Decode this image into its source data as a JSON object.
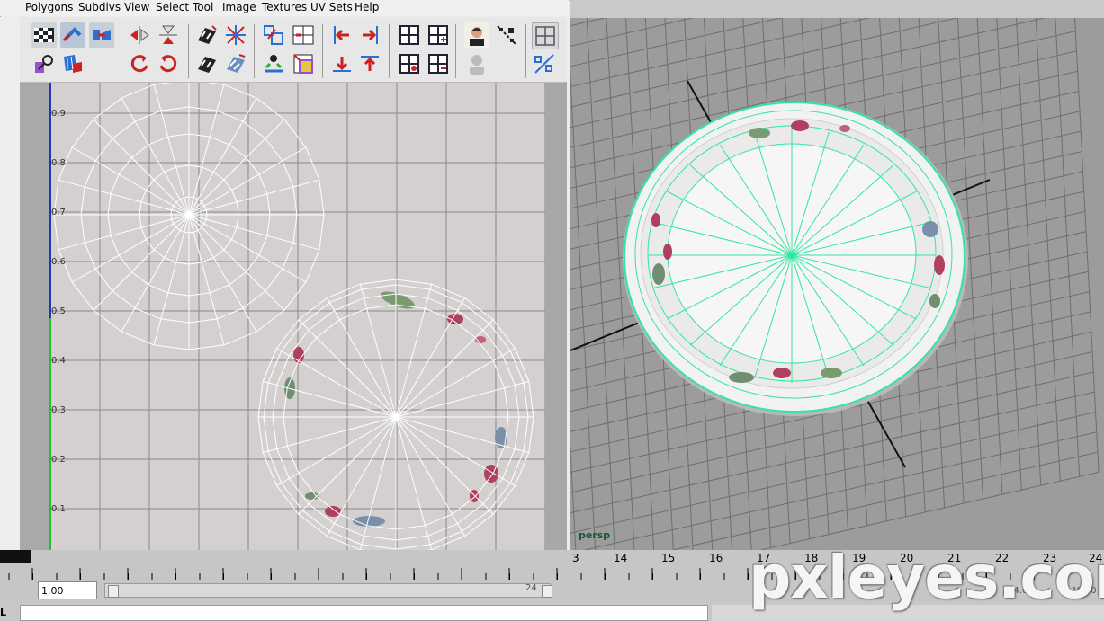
{
  "menubar": {
    "items": [
      "Polygons",
      "Subdivs",
      "View",
      "Select",
      "Tool",
      "Image",
      "Textures",
      "UV Sets",
      "Help"
    ]
  },
  "uv_editor": {
    "v_ticks": [
      "0.9",
      "0.8",
      "0.7",
      "0.6",
      "0.5",
      "0.4",
      "0.3",
      "0.2",
      "0.1"
    ]
  },
  "viewport": {
    "camera_label": "persp"
  },
  "timeline": {
    "frame_numbers": [
      "3",
      "14",
      "15",
      "16",
      "17",
      "18",
      "19",
      "20",
      "21",
      "22",
      "23",
      "24"
    ]
  },
  "range": {
    "start_value": "1.00",
    "end_label": "24",
    "right_field_1": "24.00",
    "right_field_2": "48.00"
  },
  "command_line": {
    "label": "L"
  },
  "watermark": "pxleyes.com",
  "colors": {
    "wire_selected": "#32e6a0",
    "wire_uv": "#ffffff",
    "menubar_bg": "#f0f0f0",
    "uv_bg": "#d4d0cf",
    "viewport_bg": "#9c9c9c"
  }
}
